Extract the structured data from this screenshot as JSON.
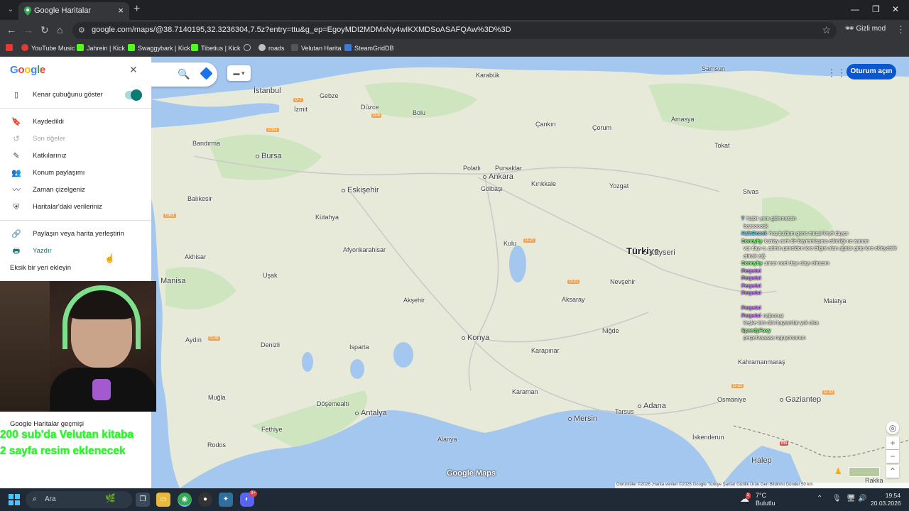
{
  "browser": {
    "tab_title": "Google Haritalar",
    "url": "google.com/maps/@38.7140195,32.3236304,7.5z?entry=ttu&g_ep=EgoyMDI2MDMxNy4wIKXMDSoASAFQAw%3D%3D",
    "incognito_label": "Gizli mod",
    "bookmarks": [
      "YouTube Music",
      "Jahrein | Kick",
      "Swaggybark | Kick",
      "Tibetius | Kick",
      "roads",
      "Velutan Harita",
      "SteamGridDB"
    ]
  },
  "sidebar": {
    "logo": [
      "G",
      "o",
      "o",
      "g",
      "l",
      "e"
    ],
    "show_sidebar_label": "Kenar çubuğunu göster",
    "show_sidebar_on": true,
    "items": [
      {
        "label": "Kaydedildi",
        "icon": "bookmark-icon"
      },
      {
        "label": "Son öğeler",
        "icon": "history-icon",
        "disabled": true
      },
      {
        "label": "Katkılarınız",
        "icon": "contributions-icon"
      },
      {
        "label": "Konum paylaşımı",
        "icon": "location-sharing-icon"
      },
      {
        "label": "Zaman çizelgeniz",
        "icon": "timeline-icon"
      },
      {
        "label": "Haritalar'daki verileriniz",
        "icon": "shield-icon"
      }
    ],
    "share_label": "Paylaşın veya harita yerleştirin",
    "print_label": "Yazdır",
    "add_place_label": "Eksik bir yeri ekleyin",
    "history_title": "Google Haritalar geçmişi"
  },
  "overlay": {
    "line1": "200 sub'da Velutan kitaba",
    "line2": "2 sayfa resim eklenecek",
    "color": "#22ff22"
  },
  "map": {
    "signin_label": "Oturum açın",
    "google_maps_logo": "Google Maps",
    "attribution": "Görüntüler ©2026 ,Harita verileri ©2026 Google   Türkiye   Şartlar   Gizlilik   Ürün Geri Bildirimi Gönder   50 km",
    "cities": [
      {
        "name": "Türkiye",
        "kind": "country"
      },
      {
        "name": "Ankara",
        "kind": "big",
        "dot": true
      },
      {
        "name": "Bursa",
        "kind": "big",
        "dot": true
      },
      {
        "name": "İstanbul",
        "kind": "big"
      },
      {
        "name": "Eskişehir",
        "kind": "big",
        "dot": true
      },
      {
        "name": "Konya",
        "kind": "big",
        "dot": true
      },
      {
        "name": "Kayseri",
        "kind": "big",
        "dot": true
      },
      {
        "name": "Antalya",
        "kind": "big",
        "dot": true
      },
      {
        "name": "Adana",
        "kind": "big",
        "dot": true
      },
      {
        "name": "Mersin",
        "kind": "big",
        "dot": true
      },
      {
        "name": "Gaziantep",
        "kind": "big",
        "dot": true
      },
      {
        "name": "Halep",
        "kind": "big"
      },
      {
        "name": "Samsun",
        "kind": "normal"
      },
      {
        "name": "Karabük",
        "kind": "normal"
      },
      {
        "name": "Bolu",
        "kind": "normal"
      },
      {
        "name": "İzmit",
        "kind": "normal"
      },
      {
        "name": "Düzce",
        "kind": "normal"
      },
      {
        "name": "Çankırı",
        "kind": "normal"
      },
      {
        "name": "Çorum",
        "kind": "normal"
      },
      {
        "name": "Amasya",
        "kind": "normal"
      },
      {
        "name": "Tokat",
        "kind": "normal"
      },
      {
        "name": "Sivas",
        "kind": "normal"
      },
      {
        "name": "Kırıkkale",
        "kind": "normal"
      },
      {
        "name": "Yozgat",
        "kind": "normal"
      },
      {
        "name": "Bandırma",
        "kind": "normal"
      },
      {
        "name": "Balıkesir",
        "kind": "normal"
      },
      {
        "name": "Kütahya",
        "kind": "normal"
      },
      {
        "name": "Akhisar",
        "kind": "normal"
      },
      {
        "name": "Manisa",
        "kind": "normal"
      },
      {
        "name": "Uşak",
        "kind": "normal"
      },
      {
        "name": "Afyonkarahisar",
        "kind": "normal"
      },
      {
        "name": "Aydın",
        "kind": "normal"
      },
      {
        "name": "Denizli",
        "kind": "normal"
      },
      {
        "name": "Isparta",
        "kind": "normal"
      },
      {
        "name": "Akşehir",
        "kind": "normal"
      },
      {
        "name": "Kulu",
        "kind": "normal"
      },
      {
        "name": "Aksaray",
        "kind": "normal"
      },
      {
        "name": "Nevşehir",
        "kind": "normal"
      },
      {
        "name": "Niğde",
        "kind": "normal"
      },
      {
        "name": "Karapınar",
        "kind": "normal"
      },
      {
        "name": "Karaman",
        "kind": "normal"
      },
      {
        "name": "Malatya",
        "kind": "normal"
      },
      {
        "name": "Osmaniye",
        "kind": "normal"
      },
      {
        "name": "Tarsus",
        "kind": "normal"
      },
      {
        "name": "Alanya",
        "kind": "normal"
      },
      {
        "name": "İskenderun",
        "kind": "normal"
      },
      {
        "name": "Rodos",
        "kind": "normal"
      },
      {
        "name": "Muğla",
        "kind": "normal"
      },
      {
        "name": "Fethiye",
        "kind": "normal"
      },
      {
        "name": "Döşemealtı",
        "kind": "normal"
      },
      {
        "name": "Polatlı",
        "kind": "normal"
      },
      {
        "name": "Gölbaşı",
        "kind": "normal"
      },
      {
        "name": "Pursaklar",
        "kind": "normal"
      },
      {
        "name": "Gebze",
        "kind": "normal"
      },
      {
        "name": "Kahramanmaraş",
        "kind": "normal"
      },
      {
        "name": "Rakka",
        "kind": "normal"
      }
    ],
    "road_badges": [
      "O-7",
      "O-4",
      "E881",
      "E881",
      "O-21",
      "O-21",
      "O-31",
      "O-32",
      "O-32",
      "M4"
    ]
  },
  "chat": [
    {
      "user": "T",
      "msg": "hiçbir yere gidemezsin",
      "color": "#4ec9ff"
    },
    {
      "user": "",
      "msg": "bozoooook",
      "color": "#ff6bd5"
    },
    {
      "user": "HalnBozok",
      "msg": "hoş buldum gene mesai keyfi dayço",
      "color": "#6fd3ff"
    },
    {
      "user": "Sonnyby",
      "msg": "kızılay avm de bayramlaşma etkinliği ne zaman",
      "color": "#7dff7d"
    },
    {
      "user": "",
      "msg": "var dayı o, admin panelden lore bilgisi olan ağalar girip lore ekleyebilir",
      "color": "#ffb84d"
    },
    {
      "user": "",
      "msg": "almak zığ",
      "color": "#ffb84d"
    },
    {
      "user": "Sonnyby",
      "msg": "aman noel dayı olayı olmasın",
      "color": "#7dff7d"
    },
    {
      "user": "Perpetvi",
      "msg": "",
      "color": "#c77dff"
    },
    {
      "user": "Perpetvi",
      "msg": "",
      "color": "#c77dff"
    },
    {
      "user": "Perpetvi",
      "msg": "",
      "color": "#c77dff"
    },
    {
      "user": "Perpetvi",
      "msg": "",
      "color": "#c77dff"
    },
    {
      "user": "",
      "msg": "",
      "color": "#6fd3ff"
    },
    {
      "user": "Perpetvi",
      "msg": "",
      "color": "#c77dff"
    },
    {
      "user": "Perpetvi",
      "msg": "nabıonuz",
      "color": "#c77dff"
    },
    {
      "user": "",
      "msg": "keşke tüm dini bayramlar yok olsa",
      "color": "#ff9f43"
    },
    {
      "user": "SpeedyFoxy",
      "msg": "",
      "color": "#7dff7d"
    },
    {
      "user": "",
      "msg": "perpetvaaaaa napıyorsunun",
      "color": "#6fd3ff"
    }
  ],
  "taskbar": {
    "search_label": "Ara",
    "weather_temp": "7°C",
    "weather_desc": "Bulutlu",
    "weather_badge": "3",
    "discord_badge": "9+",
    "time": "19:54",
    "date": "20.03.2026"
  }
}
